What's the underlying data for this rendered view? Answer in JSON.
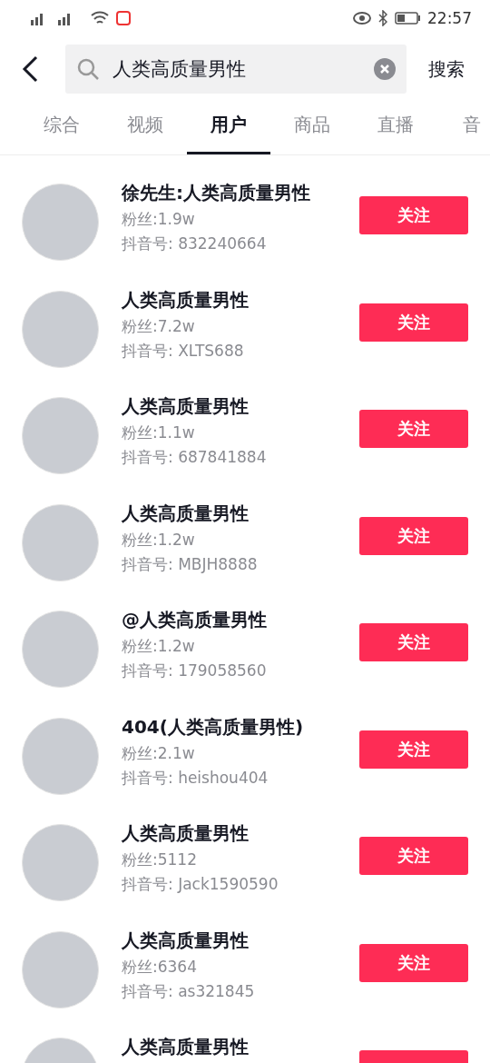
{
  "status_bar": {
    "time": "22:57"
  },
  "search": {
    "value": "人类高质量男性",
    "action": "搜索"
  },
  "tabs": [
    {
      "label": "综合",
      "selected": false
    },
    {
      "label": "视频",
      "selected": false
    },
    {
      "label": "用户",
      "selected": true
    },
    {
      "label": "商品",
      "selected": false
    },
    {
      "label": "直播",
      "selected": false
    },
    {
      "label": "音",
      "selected": false
    }
  ],
  "users": [
    {
      "name": "徐先生:人类高质量男性",
      "fans": "粉丝:1.9w",
      "id": "抖音号: 832240664",
      "button": "关注"
    },
    {
      "name": "人类高质量男性",
      "fans": "粉丝:7.2w",
      "id": "抖音号: XLTS688",
      "button": "关注"
    },
    {
      "name": "人类高质量男性",
      "fans": "粉丝:1.1w",
      "id": "抖音号: 687841884",
      "button": "关注"
    },
    {
      "name": "人类高质量男性",
      "fans": "粉丝:1.2w",
      "id": "抖音号: MBJH8888",
      "button": "关注"
    },
    {
      "name": "@人类高质量男性",
      "fans": "粉丝:1.2w",
      "id": "抖音号: 179058560",
      "button": "关注"
    },
    {
      "name": "404(人类高质量男性)",
      "fans": "粉丝:2.1w",
      "id": "抖音号: heishou404",
      "button": "关注"
    },
    {
      "name": "人类高质量男性",
      "fans": "粉丝:5112",
      "id": "抖音号: Jack1590590",
      "button": "关注"
    },
    {
      "name": "人类高质量男性",
      "fans": "粉丝:6364",
      "id": "抖音号: as321845",
      "button": "关注"
    },
    {
      "name": "人类高质量男性"
    }
  ]
}
